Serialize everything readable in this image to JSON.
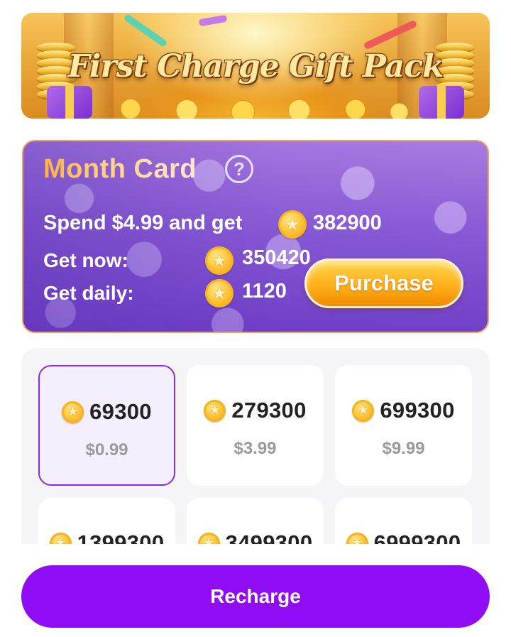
{
  "banner": {
    "title": "First Charge Gift Pack"
  },
  "month_card": {
    "title": "Month Card",
    "help_symbol": "?",
    "spend_text": "Spend $4.99 and get",
    "spend_total": "382900",
    "get_now_label": "Get now:",
    "get_now_value": "350420",
    "get_daily_label": "Get daily:",
    "get_daily_value": "1120",
    "purchase_label": "Purchase"
  },
  "coin_symbol": "★",
  "packages": [
    {
      "amount": "69300",
      "price": "$0.99",
      "selected": true
    },
    {
      "amount": "279300",
      "price": "$3.99",
      "selected": false
    },
    {
      "amount": "699300",
      "price": "$9.99",
      "selected": false
    },
    {
      "amount": "1399300",
      "price": "",
      "selected": false
    },
    {
      "amount": "3499300",
      "price": "",
      "selected": false
    },
    {
      "amount": "6999300",
      "price": "",
      "selected": false
    }
  ],
  "recharge_label": "Recharge",
  "colors": {
    "accent_purple": "#8f0cf4",
    "selected_border": "#8a2be2",
    "coin_gold": "#ffc63a",
    "purchase_orange": "#ffb01a"
  },
  "icons": {
    "coin": "star-coin-icon",
    "help": "question-circle-icon"
  }
}
